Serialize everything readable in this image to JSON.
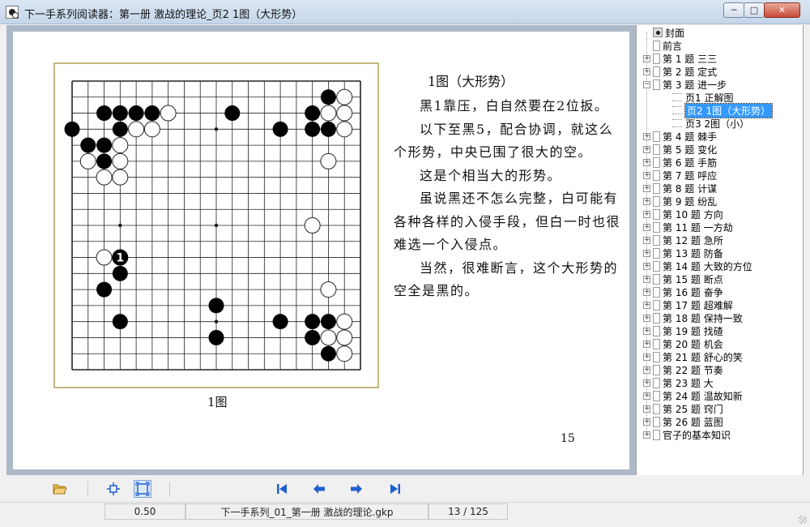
{
  "window": {
    "title": "下一手系列阅读器：第一册  激战的理论_页2  1图（大形势）",
    "minimize_icon": "minimize-icon",
    "maximize_icon": "maximize-icon",
    "close_icon": "close-icon"
  },
  "page": {
    "figure_title": "1图（大形势）",
    "paragraphs": [
      "黑1靠压，白自然要在2位扳。",
      "以下至黑5，配合协调，就这么个形势，中央已围了很大的空。",
      "这是个相当大的形势。",
      "虽说黑还不怎么完整，白可能有各种各样的入侵手段，但白一时也很难选一个入侵点。",
      "当然，很难断言，这个大形势的空全是黑的。"
    ],
    "figure_caption": "1图",
    "page_number": "15",
    "board": {
      "size": 19,
      "black": [
        [
          1,
          16
        ],
        [
          2,
          2
        ],
        [
          2,
          3
        ],
        [
          2,
          4
        ],
        [
          2,
          5
        ],
        [
          2,
          10
        ],
        [
          2,
          15
        ],
        [
          3,
          0
        ],
        [
          3,
          3
        ],
        [
          3,
          13
        ],
        [
          3,
          15
        ],
        [
          3,
          16
        ],
        [
          4,
          1
        ],
        [
          4,
          2
        ],
        [
          5,
          2
        ],
        [
          12,
          3
        ],
        [
          13,
          2
        ],
        [
          14,
          9
        ],
        [
          15,
          3
        ],
        [
          15,
          13
        ],
        [
          15,
          15
        ],
        [
          15,
          16
        ],
        [
          16,
          9
        ],
        [
          16,
          15
        ],
        [
          17,
          16
        ]
      ],
      "white": [
        [
          1,
          17
        ],
        [
          2,
          6
        ],
        [
          2,
          16
        ],
        [
          2,
          17
        ],
        [
          3,
          4
        ],
        [
          3,
          5
        ],
        [
          3,
          17
        ],
        [
          4,
          3
        ],
        [
          5,
          1
        ],
        [
          5,
          3
        ],
        [
          5,
          16
        ],
        [
          6,
          2
        ],
        [
          6,
          3
        ],
        [
          9,
          15
        ],
        [
          11,
          2
        ],
        [
          13,
          16
        ],
        [
          15,
          17
        ],
        [
          16,
          16
        ],
        [
          16,
          17
        ],
        [
          17,
          17
        ]
      ],
      "numbered": [
        {
          "row": 11,
          "col": 3,
          "color": "black",
          "label": "1"
        }
      ],
      "hoshi": [
        [
          3,
          3
        ],
        [
          3,
          9
        ],
        [
          3,
          15
        ],
        [
          9,
          3
        ],
        [
          9,
          9
        ],
        [
          9,
          15
        ],
        [
          15,
          3
        ],
        [
          15,
          9
        ],
        [
          15,
          15
        ]
      ]
    }
  },
  "sidebar": {
    "items": [
      {
        "label": "封面",
        "kind": "cover"
      },
      {
        "label": "前言",
        "kind": "doc"
      },
      {
        "label": "第 1 题   三三",
        "kind": "collapsed"
      },
      {
        "label": "第 2 题   定式",
        "kind": "collapsed"
      },
      {
        "label": "第 3 题   进一步",
        "kind": "expanded"
      },
      {
        "label": "页1   正解图",
        "kind": "page"
      },
      {
        "label": "页2   1图（大形势）",
        "kind": "page-selected"
      },
      {
        "label": "页3   2图（小）",
        "kind": "page"
      },
      {
        "label": "第 4 题   棘手",
        "kind": "collapsed"
      },
      {
        "label": "第 5 题   变化",
        "kind": "collapsed"
      },
      {
        "label": "第 6 题   手筋",
        "kind": "collapsed"
      },
      {
        "label": "第 7 题   呼应",
        "kind": "collapsed"
      },
      {
        "label": "第 8 题   计谋",
        "kind": "collapsed"
      },
      {
        "label": "第 9 题   纷乱",
        "kind": "collapsed"
      },
      {
        "label": "第 10 题   方向",
        "kind": "collapsed"
      },
      {
        "label": "第 11 题   一方劫",
        "kind": "collapsed"
      },
      {
        "label": "第 12 题   急所",
        "kind": "collapsed"
      },
      {
        "label": "第 13 题   防备",
        "kind": "collapsed"
      },
      {
        "label": "第 14 题   大致的方位",
        "kind": "collapsed"
      },
      {
        "label": "第 15 题   断点",
        "kind": "collapsed"
      },
      {
        "label": "第 16 题   奋争",
        "kind": "collapsed"
      },
      {
        "label": "第 17 题   超难解",
        "kind": "collapsed"
      },
      {
        "label": "第 18 题   保持一致",
        "kind": "collapsed"
      },
      {
        "label": "第 19 题   找碴",
        "kind": "collapsed"
      },
      {
        "label": "第 20 题   机会",
        "kind": "collapsed"
      },
      {
        "label": "第 21 题   舒心的笑",
        "kind": "collapsed"
      },
      {
        "label": "第 22 题   节奏",
        "kind": "collapsed"
      },
      {
        "label": "第 23 题   大",
        "kind": "collapsed"
      },
      {
        "label": "第 24 题   温故知新",
        "kind": "collapsed"
      },
      {
        "label": "第 25 题   窍门",
        "kind": "collapsed"
      },
      {
        "label": "第 26 题   蓝图",
        "kind": "collapsed"
      },
      {
        "label": "官子的基本知识",
        "kind": "collapsed"
      }
    ]
  },
  "toolbar": {
    "open_icon": "folder-open-icon",
    "fit_width_icon": "fit-width-icon",
    "fit_page_icon": "fit-page-icon",
    "first_icon": "first-page-icon",
    "prev_icon": "previous-page-icon",
    "next_icon": "next-page-icon",
    "last_icon": "last-page-icon"
  },
  "status": {
    "zoom": "0.50",
    "filename": "下一手系列_01_第一册  激战的理论.gkp",
    "page_counter": "13 / 125"
  },
  "colors": {
    "selection": "#3399ff",
    "board_border": "#c7b77d",
    "viewport_bg": "#aeb9c8",
    "nav_arrow": "#1f5fd0"
  }
}
